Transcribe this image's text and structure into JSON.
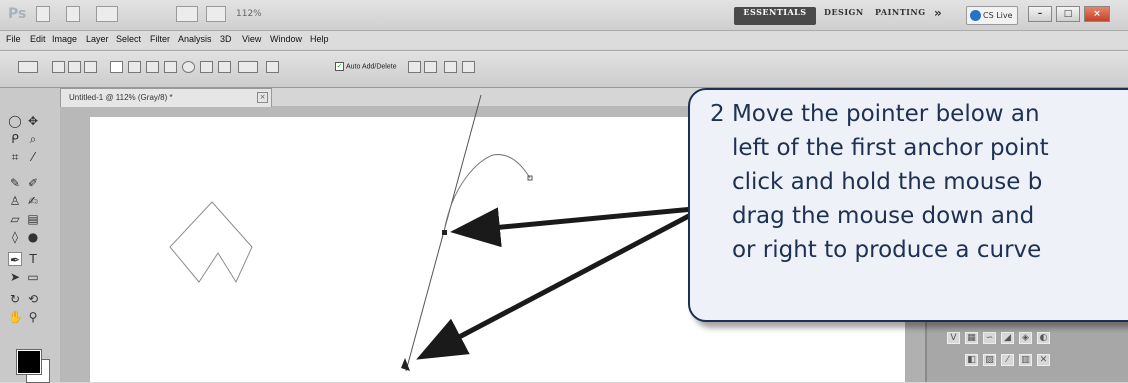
{
  "app": {
    "logo": "Ps",
    "zoom_display": "112%",
    "workspaces": [
      "ESSENTIALS",
      "DESIGN",
      "PAINTING"
    ],
    "more_workspaces": "»",
    "cs_live": "CS Live"
  },
  "menu": [
    "File",
    "Edit",
    "Image",
    "Layer",
    "Select",
    "Filter",
    "Analysis",
    "3D",
    "View",
    "Window",
    "Help"
  ],
  "options_bar": {
    "auto_add_delete": "Auto Add/Delete",
    "auto_add_delete_checked": true
  },
  "document": {
    "tab_title": "Untitled-1 @ 112% (Gray/8) *"
  },
  "colors": {
    "callout_border": "#1d2f52",
    "callout_text": "#1e3151",
    "arrow": "#1a1a1a",
    "workspace_active_bg": "#4a4a4a"
  },
  "callout": {
    "step_number": "2",
    "lines": [
      "Move the pointer below an",
      "left of the first anchor point",
      "click and hold the mouse b",
      "drag the mouse down and",
      "or right to produce a curve"
    ]
  }
}
